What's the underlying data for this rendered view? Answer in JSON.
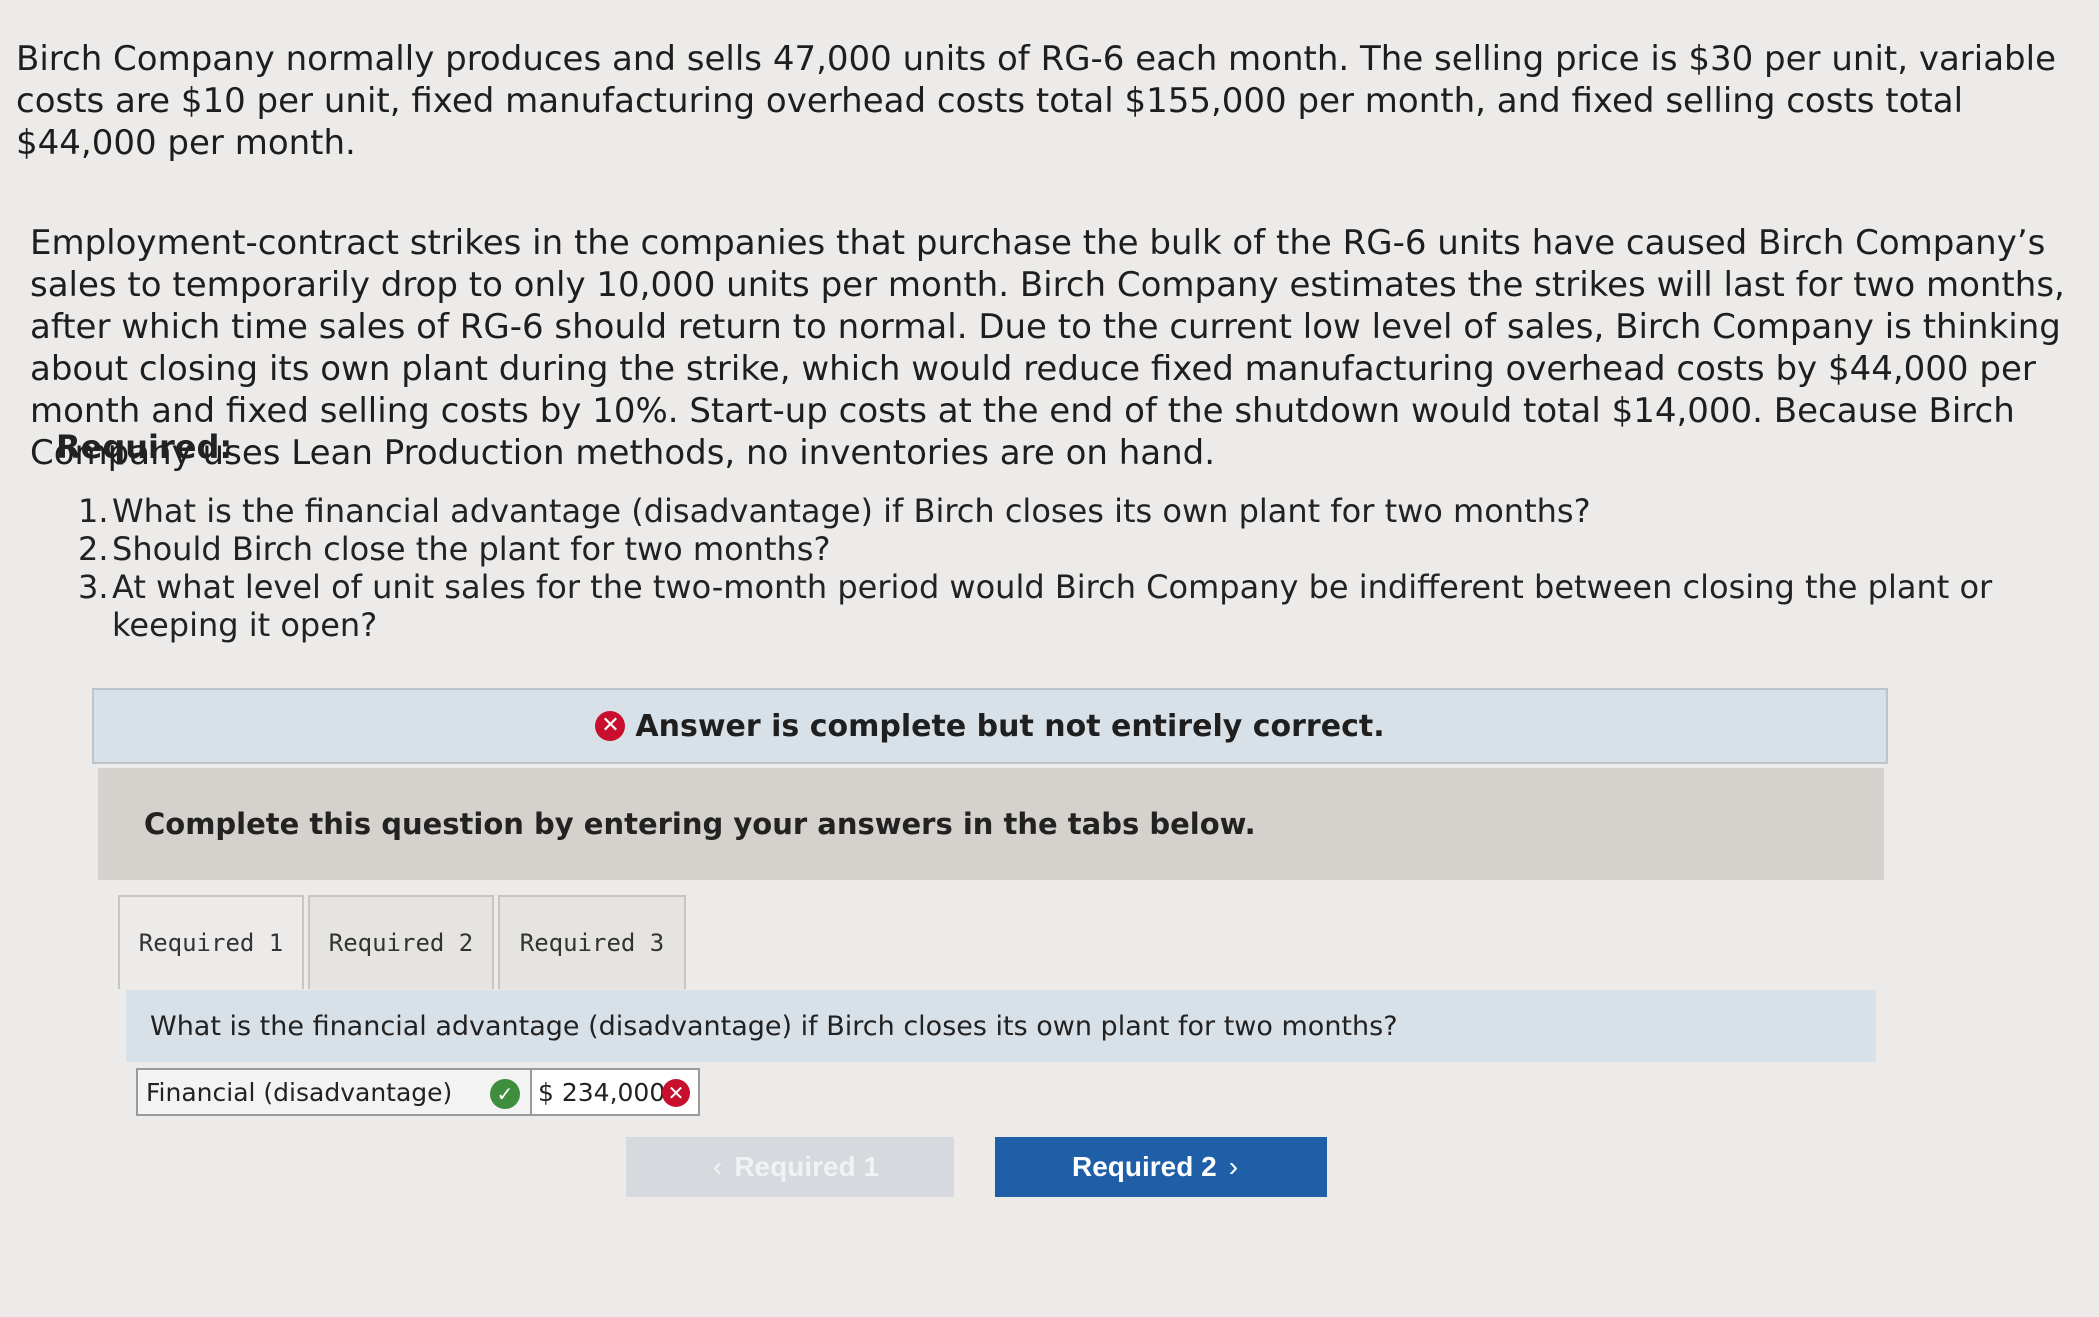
{
  "problem": {
    "paragraph1": "Birch Company normally produces and sells 47,000 units of RG-6 each month. The selling price is $30 per unit, variable costs are $10 per unit, fixed manufacturing overhead costs total $155,000 per month, and fixed selling costs total $44,000 per month.",
    "paragraph2": "Employment-contract strikes in the companies that purchase the bulk of the RG-6 units have caused Birch Company’s sales to temporarily drop to only 10,000 units per month. Birch Company estimates the strikes will last for two months, after which time sales of RG-6 should return to normal. Due to the current low level of sales, Birch Company is thinking about closing its own plant during the strike, which would reduce fixed manufacturing overhead costs by $44,000 per month and fixed selling costs by 10%. Start-up costs at the end of the shutdown would total $14,000. Because Birch Company uses Lean Production methods, no inventories are on hand."
  },
  "required": {
    "title": "Required:",
    "items": [
      {
        "num": "1.",
        "text": "What is the financial advantage (disadvantage) if Birch closes its own plant for two months?"
      },
      {
        "num": "2.",
        "text": "Should Birch close the plant for two months?"
      },
      {
        "num": "3.",
        "text": "At what level of unit sales for the two-month period would Birch Company be indifferent between closing the plant or keeping it open?"
      }
    ]
  },
  "status": {
    "icon": "x-circle-icon",
    "text": "Answer is complete but not entirely correct.",
    "color": "#c8102e"
  },
  "instruction": "Complete this question by entering your answers in the tabs below.",
  "tabs": [
    {
      "label": "Required 1"
    },
    {
      "label": "Required 2"
    },
    {
      "label": "Required 3"
    }
  ],
  "active_tab": "Required 1",
  "question": "What is the financial advantage (disadvantage) if Birch closes its own plant for two months?",
  "answer": {
    "label": "Financial (disadvantage)",
    "label_status": "correct",
    "value": "$ 234,000",
    "value_status": "incorrect"
  },
  "nav": {
    "prev_label": "Required 1",
    "next_label": "Required 2",
    "next_color": "#1f5fa8"
  }
}
